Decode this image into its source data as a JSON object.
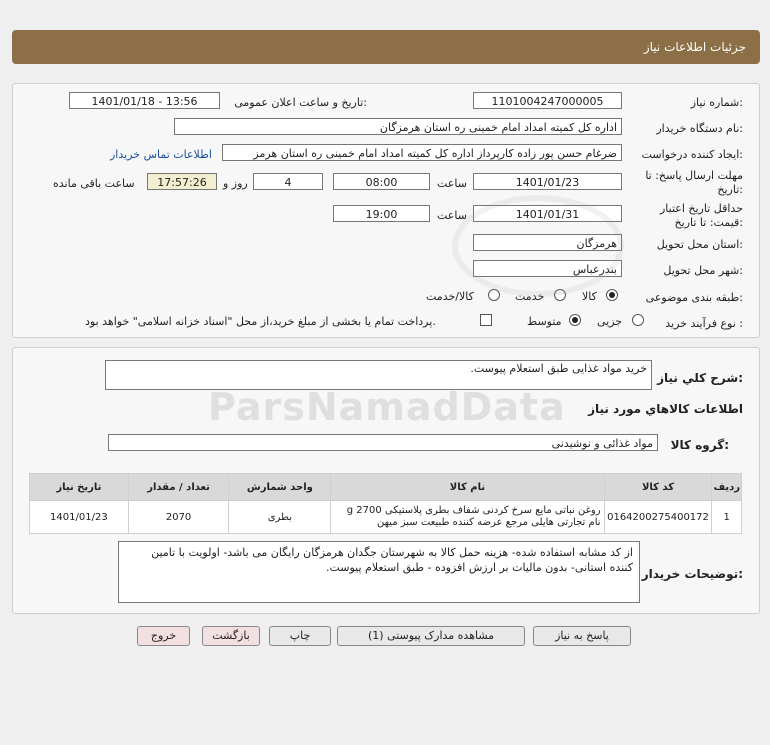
{
  "header": {
    "title": "جزئیات اطلاعات نیاز"
  },
  "form": {
    "need_number_label": "شماره نیاز:",
    "need_number": "1101004247000005",
    "announce_label": "تاریخ و ساعت اعلان عمومی:",
    "announce_value": "1401/01/18 - 13:56",
    "buyer_label": "نام دستگاه خریدار:",
    "buyer_value": "اداره کل کمیته امداد امام خمینی  ره  استان هرمزگان",
    "creator_label": "ایجاد کننده درخواست:",
    "creator_value": "ضرغام حسن پور زاده کارپرداز اداره کل کمیته امداد امام خمینی  ره  استان هرمز",
    "contact_link": "اطلاعات تماس خریدار",
    "deadline_label": "مهلت ارسال پاسخ: تا",
    "deadline_label2": "تاریخ:",
    "deadline_date": "1401/01/23",
    "time_label": "ساعت",
    "deadline_time": "08:00",
    "days_value": "4",
    "days_label": "روز و",
    "remaining_time": "17:57:26",
    "remaining_label": "ساعت باقی مانده",
    "validity_label": "حداقل تاریخ اعتبار",
    "validity_label2": "قیمت: تا تاریخ:",
    "validity_date": "1401/01/31",
    "validity_time_label": "ساعت",
    "validity_time": "19:00",
    "province_label": "استان محل تحویل:",
    "province_value": "هرمزگان",
    "city_label": "شهر محل تحویل:",
    "city_value": "بندرعباس",
    "category_label": "طبقه بندی موضوعی:",
    "category_options": [
      "کالا",
      "خدمت",
      "کالا/خدمت"
    ],
    "category_selected": "کالا",
    "process_label": "نوع فرآیند خرید :",
    "process_options": [
      "جزیی",
      "متوسط"
    ],
    "process_selected": "متوسط",
    "payment_note": "پرداخت تمام یا بخشی از مبلغ خرید،از محل \"اسناد خزانه اسلامی\" خواهد بود."
  },
  "details": {
    "summary_label": "شرح کلي نياز:",
    "summary_value": "خرید مواد غذایی طبق استعلام پیوست.",
    "goods_info_title": "اطلاعات کالاهاي مورد نياز",
    "group_label": "گروه کالا:",
    "group_value": "مواد غذائی و نوشیدنی",
    "table": {
      "headers": [
        "ردیف",
        "کد کالا",
        "نام کالا",
        "واحد شمارش",
        "تعداد / مقدار",
        "تاریخ نیاز"
      ],
      "rows": [
        {
          "row": "1",
          "code": "0164200275400172",
          "name_line1": "روغن نباتی مایع سرخ کردنی شفاف بطری پلاستیکی 2700 g",
          "name_line2": "نام تجارتی هایلی مرجع عرضه کننده طبیعت سبز میهن",
          "unit": "بطری",
          "qty": "2070",
          "date": "1401/01/23"
        }
      ]
    },
    "buyer_notes_label": "توضیحات خریدار:",
    "buyer_notes": "از کد مشابه استفاده شده- هزینه حمل کالا به شهرستان جگدان هرمزگان رایگان می باشد- اولویت با تامین کننده استانی- بدون مالیات بر ارزش افزوده - طبق استعلام پیوست."
  },
  "buttons": {
    "reply": "پاسخ به نیاز",
    "attachments": "مشاهده مدارک پیوستی (1)",
    "print": "چاپ",
    "back": "بازگشت",
    "exit": "خروج"
  },
  "watermark": {
    "text": "ParsNamadData"
  },
  "colors": {
    "header_bg": "#8c6f47",
    "link": "#1a4fa0",
    "remaining_bg": "#f4eed0"
  }
}
